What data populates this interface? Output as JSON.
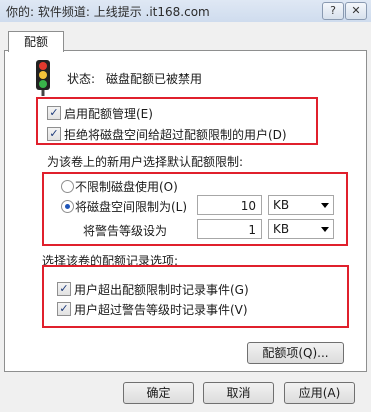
{
  "window": {
    "title": "你的: 软件频道: 上线提示 .it168.com"
  },
  "tabs": [
    {
      "label": "配额"
    }
  ],
  "status": {
    "label": "状态:",
    "value": "磁盘配额已被禁用"
  },
  "quota_management": {
    "enable_label": "启用配额管理(E)",
    "enable_checked": true,
    "deny_label": "拒绝将磁盘空间给超过配额限制的用户(D)",
    "deny_checked": true
  },
  "defaults": {
    "heading": "为该卷上的新用户选择默认配额限制:",
    "unlimited_label": "不限制磁盘使用(O)",
    "unlimited_selected": false,
    "limit_label": "将磁盘空间限制为(L)",
    "limit_selected": true,
    "limit_value": "10",
    "limit_unit": "KB",
    "warning_label": "将警告等级设为",
    "warning_value": "1",
    "warning_unit": "KB"
  },
  "logging": {
    "heading": "选择该卷的配额记录选项:",
    "over_limit_label": "用户超出配额限制时记录事件(G)",
    "over_limit_checked": true,
    "over_warning_label": "用户超过警告等级时记录事件(V)",
    "over_warning_checked": true
  },
  "buttons": {
    "quota_entries": "配额项(Q)...",
    "ok": "确定",
    "cancel": "取消",
    "apply": "应用(A)"
  },
  "colors": {
    "highlight": "#e0202c",
    "radio_selected": "#1f55b8"
  }
}
